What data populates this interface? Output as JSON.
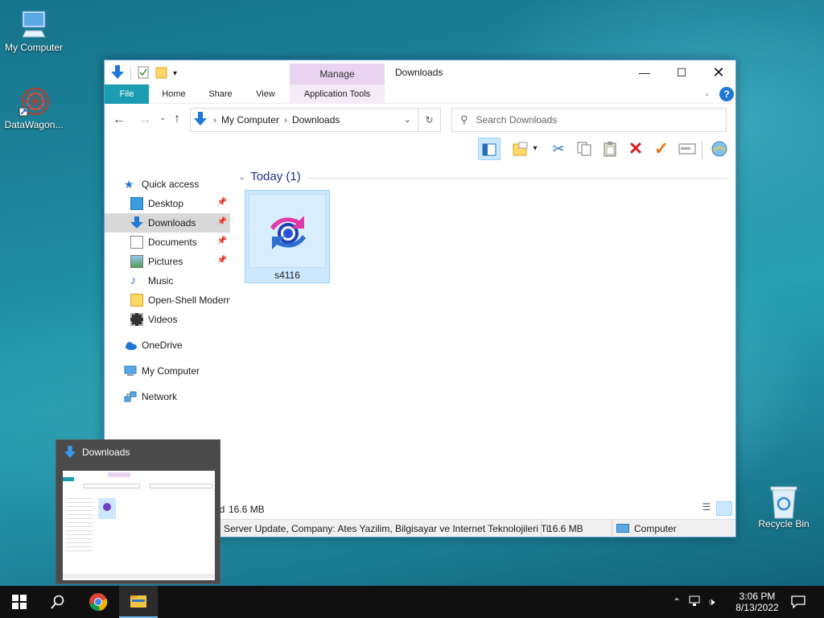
{
  "desktop": {
    "icons": [
      {
        "label": "My Computer"
      },
      {
        "label": "DataWagon..."
      },
      {
        "label": "Recycle Bin"
      }
    ]
  },
  "window": {
    "title": "Downloads",
    "manage_label": "Manage",
    "tabs": [
      "File",
      "Home",
      "Share",
      "View",
      "Application Tools"
    ],
    "address": {
      "crumbs": [
        "My Computer",
        "Downloads"
      ]
    },
    "search_placeholder": "Search Downloads",
    "nav": {
      "quick_access": "Quick access",
      "items": [
        {
          "label": "Desktop",
          "pinned": true
        },
        {
          "label": "Downloads",
          "pinned": true
        },
        {
          "label": "Documents",
          "pinned": true
        },
        {
          "label": "Pictures",
          "pinned": true
        },
        {
          "label": "Music",
          "pinned": false
        },
        {
          "label": "Open-Shell Modern",
          "pinned": false
        },
        {
          "label": "Videos",
          "pinned": false
        }
      ],
      "onedrive": "OneDrive",
      "my_computer": "My Computer",
      "network": "Network"
    },
    "group_header": "Today (1)",
    "file": {
      "name": "s4116"
    },
    "status": {
      "selected_size": "16.6 MB",
      "prefix": "ed"
    },
    "info": {
      "description": "re Server Update, Company: Ates Yazilim, Bilgisayar ve Internet Teknolojileri Ti",
      "size": "16.6 MB",
      "location": "Computer"
    }
  },
  "preview": {
    "title": "Downloads"
  },
  "taskbar": {
    "time": "3:06 PM",
    "date": "8/13/2022"
  },
  "colors": {
    "accent": "#1a9db1",
    "manage": "#e8d3f1",
    "selection": "#cce8ff"
  }
}
